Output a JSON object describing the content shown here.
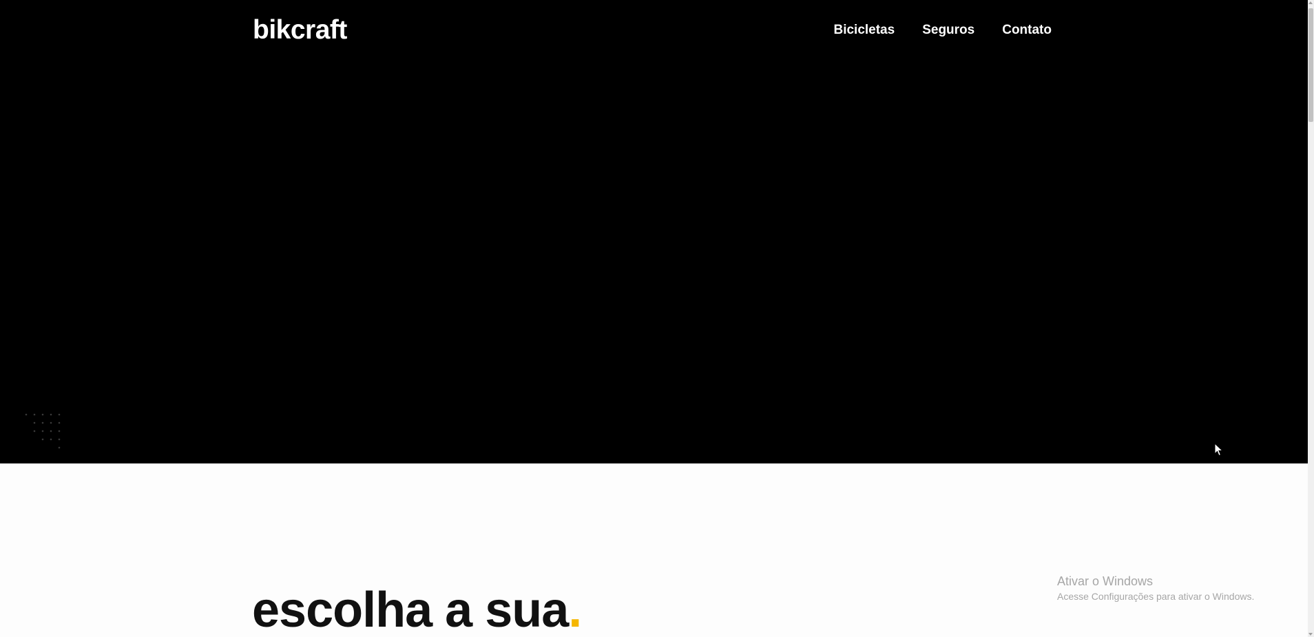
{
  "header": {
    "logo": "bikcraft",
    "nav": [
      {
        "label": "Bicicletas"
      },
      {
        "label": "Seguros"
      },
      {
        "label": "Contato"
      }
    ]
  },
  "section": {
    "title": "escolha a sua",
    "title_accent": "."
  },
  "watermark": {
    "title": "Ativar o Windows",
    "subtitle": "Acesse Configurações para ativar o Windows."
  },
  "colors": {
    "hero_bg": "#000000",
    "accent": "#f5b600",
    "text_dark": "#111111",
    "page_bg": "#fdfdfd"
  },
  "icons": {
    "decoration": "dot-grid-pattern",
    "cursor": "mouse-pointer-icon"
  }
}
